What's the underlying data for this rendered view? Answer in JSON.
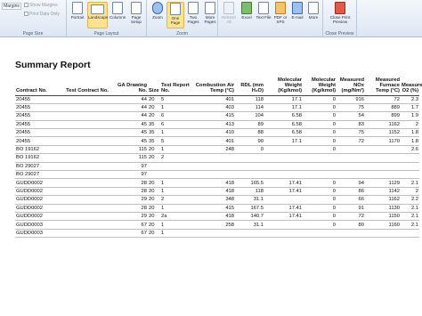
{
  "ribbon": {
    "page_size": {
      "margins": "Margins",
      "show_margins": "Show Margins",
      "print_data_only": "Print Data Only",
      "label": "Page Size"
    },
    "page_layout": {
      "portrait": "Portrait",
      "landscape": "Landscape",
      "columns": "Columns",
      "page_setup": "Page Setup",
      "label": "Page Layout"
    },
    "zoom": {
      "zoom": "Zoom",
      "one_page": "One Page",
      "two_pages": "Two Pages",
      "more_pages": "More Pages",
      "label": "Zoom"
    },
    "data": {
      "refresh_all": "Refresh All",
      "excel": "Excel",
      "text_file": "Text File",
      "pdf_or_xps": "PDF or XPS",
      "email": "E-mail",
      "more": "More"
    },
    "close_preview": {
      "close": "Close Print Preview",
      "label": "Close Preview"
    }
  },
  "report": {
    "title": "Summary Report",
    "headers": [
      "Contract No.",
      "Test Contract No.",
      "GA Drawing No.",
      "Size",
      "Test Report No.",
      "Combustion Air Temp (°C)",
      "RDL (mm H₂O)",
      "Molecular Weight (Kg/kmol)",
      "Molecular Weight (Kg/kmol)",
      "Measured NOx (mg/Nm³)",
      "Measured Furnace Temp (°C)",
      "Measured O2 (%)"
    ],
    "rows": [
      [
        "20455",
        "",
        "44",
        "20",
        "5",
        "401",
        "118",
        "17.1",
        "0",
        "916",
        "72",
        "2.3"
      ],
      [
        "20455",
        "",
        "44",
        "20",
        "1",
        "403",
        "114",
        "17.1",
        "0",
        "75",
        "889",
        "1.7"
      ],
      [
        "20455",
        "",
        "44",
        "20",
        "6",
        "415",
        "104",
        "6.58",
        "0",
        "54",
        "899",
        "1.9"
      ],
      [
        "20455",
        "",
        "45",
        "35",
        "6",
        "413",
        "89",
        "6.58",
        "0",
        "83",
        "1162",
        "2"
      ],
      [
        "20455",
        "",
        "45",
        "35",
        "1",
        "410",
        "88",
        "6.58",
        "0",
        "75",
        "1152",
        "1.8"
      ],
      [
        "20455",
        "",
        "45",
        "35",
        "5",
        "401",
        "90",
        "17.1",
        "0",
        "72",
        "1170",
        "1.8"
      ],
      [
        "BO 19162",
        "",
        "115",
        "20",
        "1",
        "248",
        "0",
        "",
        "0",
        "",
        "",
        "2.6"
      ],
      [
        "BO 19162",
        "",
        "115",
        "20",
        "2",
        "",
        "",
        "",
        "",
        "",
        "",
        ""
      ],
      [
        "BO 29027",
        "",
        "97",
        "",
        "",
        "",
        "",
        "",
        "",
        "",
        "",
        ""
      ],
      [
        "BO 29027",
        "",
        "97",
        "",
        "",
        "",
        "",
        "",
        "",
        "",
        "",
        ""
      ],
      [
        "GUDD0002",
        "",
        "28",
        "20",
        "1",
        "418",
        "165.5",
        "17.41",
        "0",
        "94",
        "1129",
        "2.1"
      ],
      [
        "GUDD0002",
        "",
        "28",
        "20",
        "1",
        "418",
        "118",
        "17.41",
        "0",
        "86",
        "1142",
        "2"
      ],
      [
        "GUDD0002",
        "",
        "29",
        "20",
        "2",
        "348",
        "31.1",
        "",
        "0",
        "66",
        "1162",
        "2.2"
      ],
      [
        "GUDD0002",
        "",
        "28",
        "20",
        "1",
        "415",
        "167.5",
        "17.41",
        "0",
        "91",
        "1130",
        "2.1"
      ],
      [
        "GUDD0002",
        "",
        "29",
        "20",
        "2a",
        "418",
        "140.7",
        "17.41",
        "0",
        "72",
        "1150",
        "2.1"
      ],
      [
        "GUDD0003",
        "",
        "67",
        "20",
        "1",
        "258",
        "31.1",
        "",
        "0",
        "80",
        "1160",
        "2.1"
      ],
      [
        "GUDD0003",
        "",
        "67",
        "20",
        "1",
        "",
        "",
        "",
        "",
        "",
        "",
        ""
      ]
    ]
  }
}
